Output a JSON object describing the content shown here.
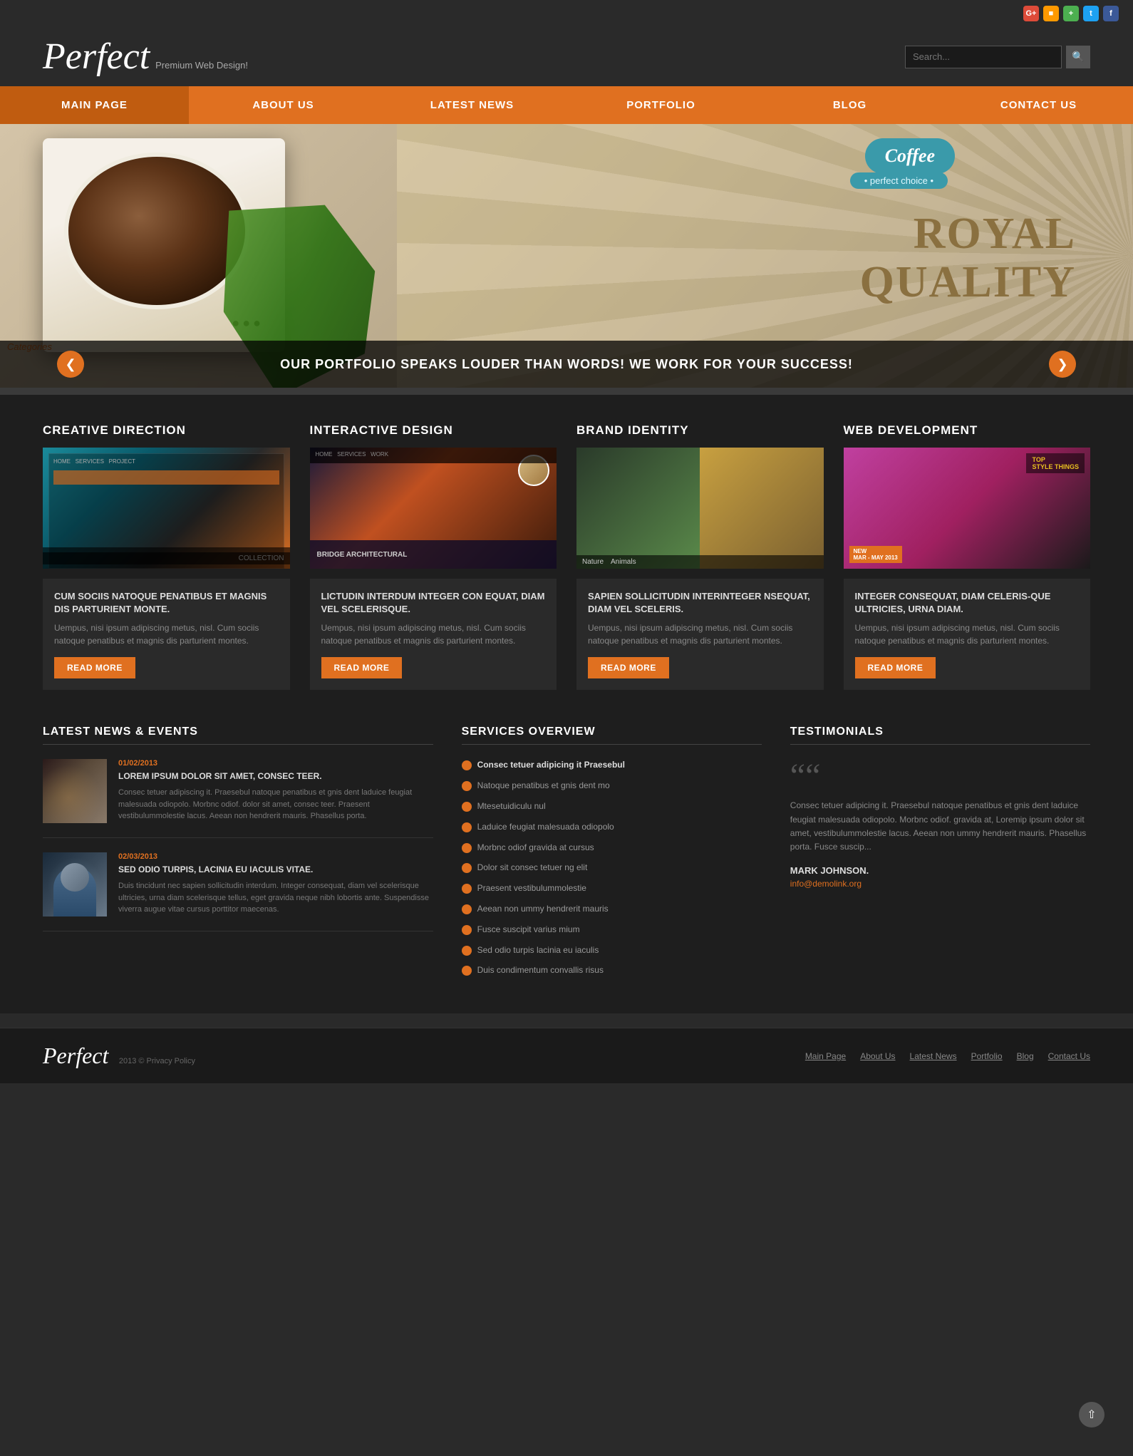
{
  "site": {
    "logo": "Perfect",
    "logo_sub": "Premium Web Design!",
    "copyright": "2013 © Privacy Policy"
  },
  "social": [
    {
      "name": "google-plus",
      "label": "G+",
      "class": "si-gplus"
    },
    {
      "name": "rss",
      "label": "RSS",
      "class": "si-rss"
    },
    {
      "name": "green-social",
      "label": "●",
      "class": "si-green"
    },
    {
      "name": "twitter",
      "label": "T",
      "class": "si-twitter"
    },
    {
      "name": "facebook",
      "label": "f",
      "class": "si-facebook"
    }
  ],
  "search": {
    "placeholder": "Search..."
  },
  "nav": [
    {
      "id": "main-page",
      "label": "MAIN PAGE"
    },
    {
      "id": "about-us",
      "label": "ABOUT US"
    },
    {
      "id": "latest-news",
      "label": "LATEST NEWS"
    },
    {
      "id": "portfolio",
      "label": "PORTFOLIO"
    },
    {
      "id": "blog",
      "label": "BLOG"
    },
    {
      "id": "contact-us",
      "label": "CONTACT US"
    }
  ],
  "hero": {
    "caption": "OUR PORTFOLIO SPEAKS LOUDER THAN WORDS! WE WORK FOR YOUR SUCCESS!",
    "coffee_label": "Coffee",
    "coffee_sub": "• perfect choice •",
    "royal_line1": "ROYAL",
    "royal_line2": "QUALITY",
    "categories_label": "Categories"
  },
  "sections": [
    {
      "id": "creative-direction",
      "title": "CREATIVE DIRECTION",
      "img_class": "img-creative",
      "card_title": "CUM SOCIIS NATOQUE PENATIBUS ET MAGNIS DIS PARTURIENT MONTE.",
      "card_text": "Uempus, nisi ipsum adipiscing metus, nisl. Cum sociis natoque penatibus et magnis dis parturient montes.",
      "btn_label": "Read More"
    },
    {
      "id": "interactive-design",
      "title": "INTERACTIVE DESIGN",
      "img_class": "img-interactive",
      "card_title": "LICTUDIN INTERDUM INTEGER CON EQUAT, DIAM VEL SCELERISQUE.",
      "card_text": "Uempus, nisi ipsum adipiscing metus, nisl. Cum sociis natoque penatibus et magnis dis parturient montes.",
      "btn_label": "Read More"
    },
    {
      "id": "brand-identity",
      "title": "BRAND IDENTITY",
      "img_class": "img-brand",
      "card_title": "SAPIEN SOLLICITUDIN INTERINTEGER NSEQUAT, DIAM VEL SCELERIS.",
      "card_text": "Uempus, nisi ipsum adipiscing metus, nisl. Cum sociis natoque penatibus et magnis dis parturient montes.",
      "btn_label": "Read More"
    },
    {
      "id": "web-development",
      "title": "WEB DEVELOPMENT",
      "img_class": "img-web",
      "card_title": "INTEGER CONSEQUAT, DIAM CELERIS-QUE ULTRICIES, URNA DIAM.",
      "card_text": "Uempus, nisi ipsum adipiscing metus, nisl. Cum sociis natoque penatibus et magnis dis parturient montes.",
      "btn_label": "Read More"
    }
  ],
  "latest_news": {
    "title": "LATEST NEWS & EVENTS",
    "items": [
      {
        "date": "01/02/2013",
        "title": "LOREM IPSUM DOLOR SIT AMET, CONSEC TEER.",
        "text": "Consec tetuer adipiscing it. Praesebul natoque penatibus et gnis dent laduice feugiat malesuada odiopolo. Morbnc odiof. dolor sit amet, consec teer. Praesent vestibulummolestie lacus. Aeean non hendrerit mauris. Phasellus porta."
      },
      {
        "date": "02/03/2013",
        "title": "SED ODIO TURPIS, LACINIA EU IACULIS VITAE.",
        "text": "Duis tincidunt nec sapien sollicitudin interdum. Integer consequat, diam vel scelerisque ultricies, urna diam scelerisque tellus, eget gravida neque nibh lobortis ante. Suspendisse viverra augue vitae cursus porttitor maecenas."
      }
    ]
  },
  "services": {
    "title": "SERVICES OVERVIEW",
    "items": [
      {
        "text": "Consec tetuer adipicing it Praesebul",
        "highlight": true
      },
      {
        "text": "Natoque penatibus et gnis dent mo",
        "highlight": false
      },
      {
        "text": "Mtesetuidiculu nul",
        "highlight": false
      },
      {
        "text": "Laduice feugiat malesuada odiopolo",
        "highlight": false
      },
      {
        "text": "Morbnc odiof gravida at cursus",
        "highlight": false
      },
      {
        "text": "Dolor sit consec tetuer ng elit",
        "highlight": false
      },
      {
        "text": "Praesent vestibulummolestie",
        "highlight": false
      },
      {
        "text": "Aeean non ummy hendrerit mauris",
        "highlight": false
      },
      {
        "text": "Fusce suscipit varius mium",
        "highlight": false
      },
      {
        "text": "Sed odio turpis lacinia eu iaculis",
        "highlight": false
      },
      {
        "text": "Duis condimentum convallis risus",
        "highlight": false
      }
    ]
  },
  "testimonials": {
    "title": "TESTIMONIALS",
    "quote_icon": "““",
    "text": "Consec tetuer adipicing it. Praesebul natoque penatibus et gnis dent laduice feugiat malesuada odiopolo. Morbnc odiof. gravida at, Loremip ipsum dolor sit amet, vestibulummolestie lacus. Aeean non ummy hendrerit mauris. Phasellus porta. Fusce suscip...",
    "author": "MARK JOHNSON.",
    "email": "info@demolink.org"
  },
  "footer": {
    "logo": "Perfect",
    "copyright": "2013 © Privacy Policy",
    "nav": [
      {
        "label": "Main Page"
      },
      {
        "label": "About Us"
      },
      {
        "label": "Latest News"
      },
      {
        "label": "Portfolio"
      },
      {
        "label": "Blog"
      },
      {
        "label": "Contact Us"
      }
    ]
  }
}
